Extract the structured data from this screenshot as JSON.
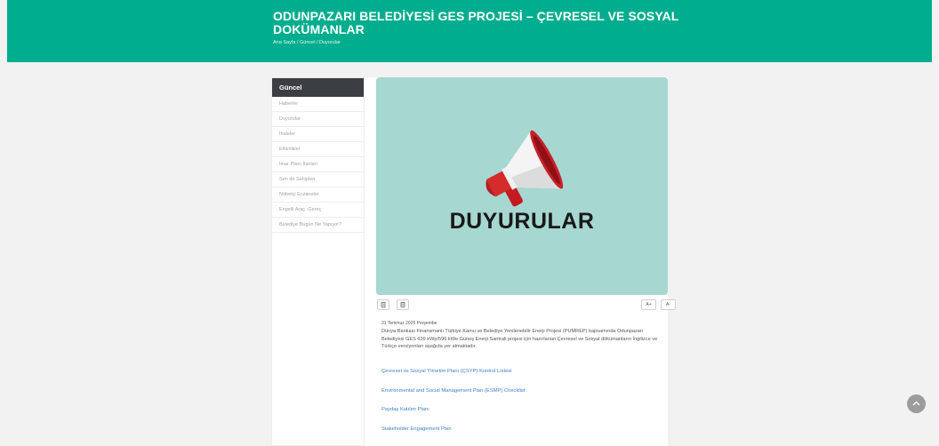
{
  "header": {
    "title_line1": "ODUNPAZARI BELEDİYESİ GES PROJESİ – ÇEVRESEL VE SOSYAL",
    "title_line2": "DOKÜMANLAR",
    "breadcrumb": [
      "Ana Sayfa",
      "Güncel",
      "Duyurular"
    ],
    "breadcrumb_separator": "/",
    "color": "#00ad8e"
  },
  "sidebar": {
    "heading": "Güncel",
    "items": [
      "Haberler",
      "Duyurular",
      "İhaleler",
      "Etkinlikler",
      "İmar Planı İlanları",
      "Sen de Sahiplen",
      "Nöbetçi Eczaneler",
      "Engelli Araç -Gereç",
      "Belediye Bugün Ne Yapıyor?"
    ]
  },
  "hero": {
    "text": "DUYURULAR",
    "icon": "megaphone-icon",
    "background": "#a6d7d1"
  },
  "toolbar": {
    "print_icon": "print-icon",
    "share_icon": "document-icon",
    "font_increase": "A+",
    "font_decrease": "A-"
  },
  "article": {
    "date": "31 Temmuz 2025 Perşembe",
    "body": "Dünya Bankası Finansmanlı Türkiye Kamu ve Belediye Yenilenebilir Enerji Projesi (PUMREP) kapsamında Odunpazarı Belediyesi GES 639 kWp/596 kWe Güneş Enerji Santrali projesi için hazırlanan Çevresel ve Sosyal dökümanların  İngilizce ve Türkçe versiyonları aşağıda yer almaktadır.",
    "links": [
      "Çevresel ve Sosyal Yönetim Planı (ÇSYP) Kontrol Listesi",
      "Environmental and Social Management Plan (ESMP) Checklist",
      "Paydaş Katılım Planı",
      "Stakeholder Engagement Plan"
    ],
    "link_color": "#3d82c8"
  },
  "scroll_top_icon": "arrow-up-icon"
}
